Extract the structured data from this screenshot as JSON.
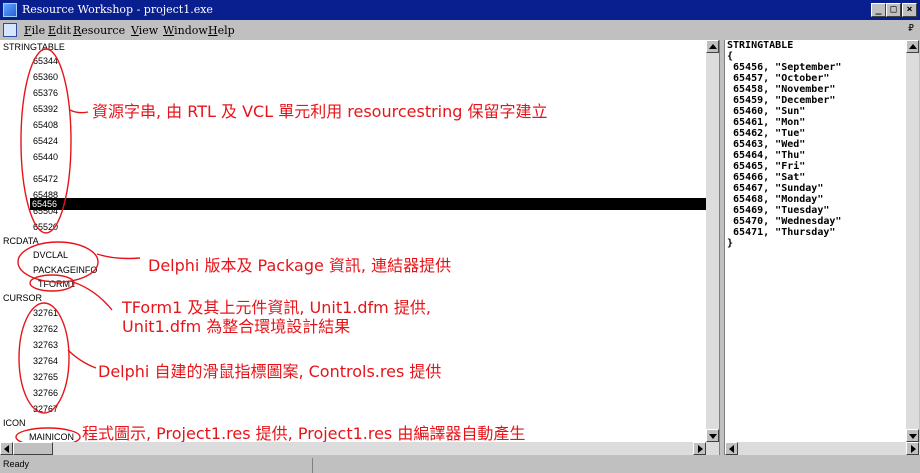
{
  "window": {
    "title": "Resource Workshop - project1.exe"
  },
  "menu": [
    {
      "name": "File",
      "mnemonic": "F",
      "rest": "ile"
    },
    {
      "name": "Edit",
      "mnemonic": "E",
      "rest": "dit"
    },
    {
      "name": "Resource",
      "mnemonic": "R",
      "rest": "esource"
    },
    {
      "name": "View",
      "mnemonic": "V",
      "rest": "iew"
    },
    {
      "name": "Window",
      "mnemonic": "W",
      "rest": "indow"
    },
    {
      "name": "Help",
      "mnemonic": "H",
      "rest": "elp"
    }
  ],
  "tree": {
    "stringtable": {
      "label": "STRINGTABLE",
      "items": [
        "65344",
        "65360",
        "65376",
        "65392",
        "65408",
        "65424",
        "65440",
        "65456",
        "65472",
        "65488",
        "65504",
        "65520"
      ],
      "selected": "65456"
    },
    "rcdata": {
      "label": "RCDATA",
      "items": [
        "DVCLAL",
        "PACKAGEINFO",
        "TFORM1"
      ]
    },
    "cursor": {
      "label": "CURSOR",
      "items": [
        "32761",
        "32762",
        "32763",
        "32764",
        "32765",
        "32766",
        "32767"
      ]
    },
    "icon": {
      "label": "ICON",
      "items": [
        "MAINICON"
      ]
    }
  },
  "annotations": {
    "strings": "資源字串, 由 RTL 及 VCL 單元利用 resourcestring 保留字建立",
    "rcdata": "Delphi 版本及 Package 資訊, 連結器提供",
    "tform_line1": "TForm1 及其上元件資訊, Unit1.dfm 提供,",
    "tform_line2": "Unit1.dfm 為整合環境設計結果",
    "cursor": "Delphi 自建的滑鼠指標圖案, Controls.res 提供",
    "icon": "程式圖示, Project1.res 提供, Project1.res 由編譯器自動產生"
  },
  "code": {
    "header": "STRINGTABLE",
    "open": "{",
    "lines": [
      "65456, \"September\"",
      "65457, \"October\"",
      "65458, \"November\"",
      "65459, \"December\"",
      "65460, \"Sun\"",
      "65461, \"Mon\"",
      "65462, \"Tue\"",
      "65463, \"Wed\"",
      "65464, \"Thu\"",
      "65465, \"Fri\"",
      "65466, \"Sat\"",
      "65467, \"Sunday\"",
      "65468, \"Monday\"",
      "65469, \"Tuesday\"",
      "65470, \"Wednesday\"",
      "65471, \"Thursday\""
    ],
    "close": "}"
  },
  "status": {
    "text": "Ready"
  },
  "colors": {
    "titlebar": "#0a1f8f",
    "annotation": "#e6141a",
    "selection": "#000000"
  },
  "icons": [
    "app-icon",
    "mdi-child-icon",
    "minimize-icon",
    "maximize-icon",
    "close-icon",
    "restore-icon",
    "scroll-up-icon",
    "scroll-down-icon",
    "scroll-left-icon",
    "scroll-right-icon"
  ]
}
